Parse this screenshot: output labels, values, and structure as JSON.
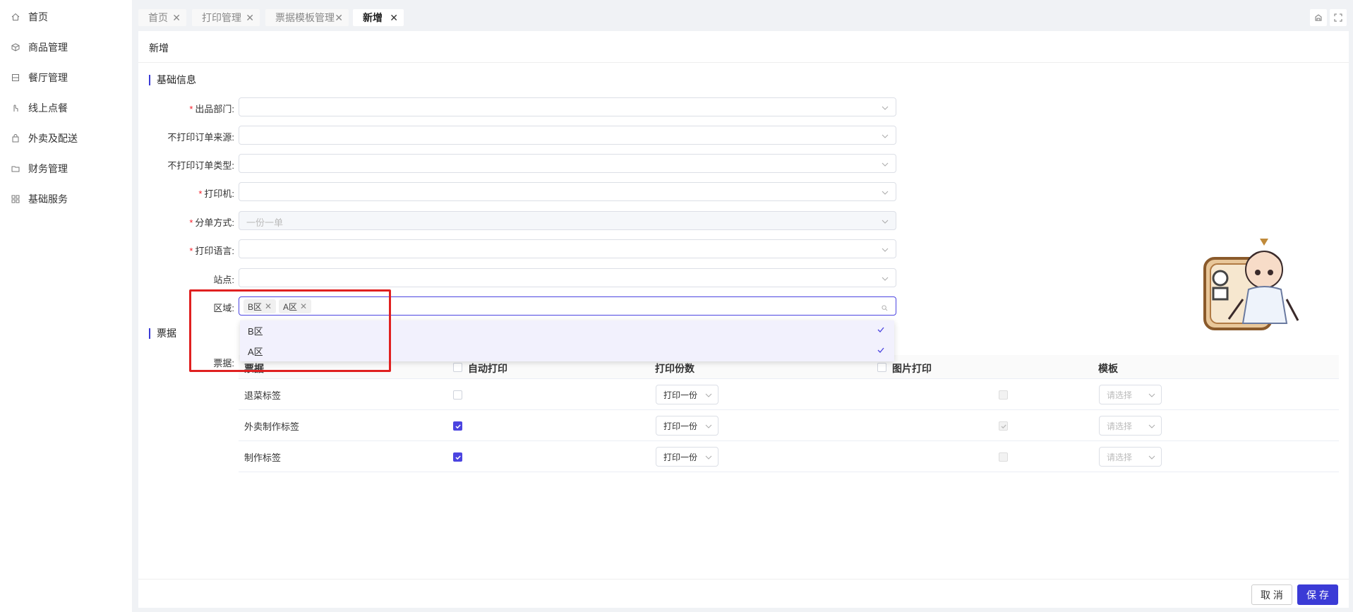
{
  "sidebar": {
    "items": [
      {
        "label": "首页",
        "icon": "home-icon"
      },
      {
        "label": "商品管理",
        "icon": "box-icon"
      },
      {
        "label": "餐厅管理",
        "icon": "restaurant-icon"
      },
      {
        "label": "线上点餐",
        "icon": "hand-icon"
      },
      {
        "label": "外卖及配送",
        "icon": "bag-icon"
      },
      {
        "label": "财务管理",
        "icon": "folder-icon"
      },
      {
        "label": "基础服务",
        "icon": "grid-icon"
      }
    ]
  },
  "tabs": [
    {
      "label": "首页",
      "active": false
    },
    {
      "label": "打印管理",
      "active": false
    },
    {
      "label": "票据模板管理",
      "active": false
    },
    {
      "label": "新增",
      "active": true
    }
  ],
  "panel": {
    "title": "新增",
    "section_basic": "基础信息",
    "section_ticket": "票据"
  },
  "form": {
    "fields": [
      {
        "label": "出品部门:",
        "required": true,
        "value": ""
      },
      {
        "label": "不打印订单来源:",
        "required": false,
        "value": ""
      },
      {
        "label": "不打印订单类型:",
        "required": false,
        "value": ""
      },
      {
        "label": "打印机:",
        "required": true,
        "value": ""
      },
      {
        "label": "分单方式:",
        "required": true,
        "value": "一份一单",
        "disabled": true
      },
      {
        "label": "打印语言:",
        "required": true,
        "value": ""
      },
      {
        "label": "站点:",
        "required": false,
        "value": ""
      }
    ],
    "region": {
      "label": "区域:",
      "chips": [
        "B区",
        "A区"
      ],
      "options": [
        {
          "label": "B区",
          "selected": true
        },
        {
          "label": "A区",
          "selected": true
        }
      ]
    },
    "ticket_label": "票据:"
  },
  "table": {
    "headers": {
      "name": "票据",
      "auto_print": "自动打印",
      "count": "打印份数",
      "image_print": "图片打印",
      "template": "模板"
    },
    "rows": [
      {
        "name": "退菜标签",
        "auto_print": false,
        "count": "打印一份",
        "image_print": false,
        "template_placeholder": "请选择"
      },
      {
        "name": "外卖制作标签",
        "auto_print": true,
        "count": "打印一份",
        "image_print": true,
        "template_placeholder": "请选择"
      },
      {
        "name": "制作标签",
        "auto_print": true,
        "count": "打印一份",
        "image_print": false,
        "template_placeholder": "请选择"
      }
    ]
  },
  "footer": {
    "cancel_label": "取 消",
    "save_label": "保 存"
  },
  "colors": {
    "accent": "#3b3bd6",
    "required": "#f5222d",
    "highlight": "#e02020"
  }
}
